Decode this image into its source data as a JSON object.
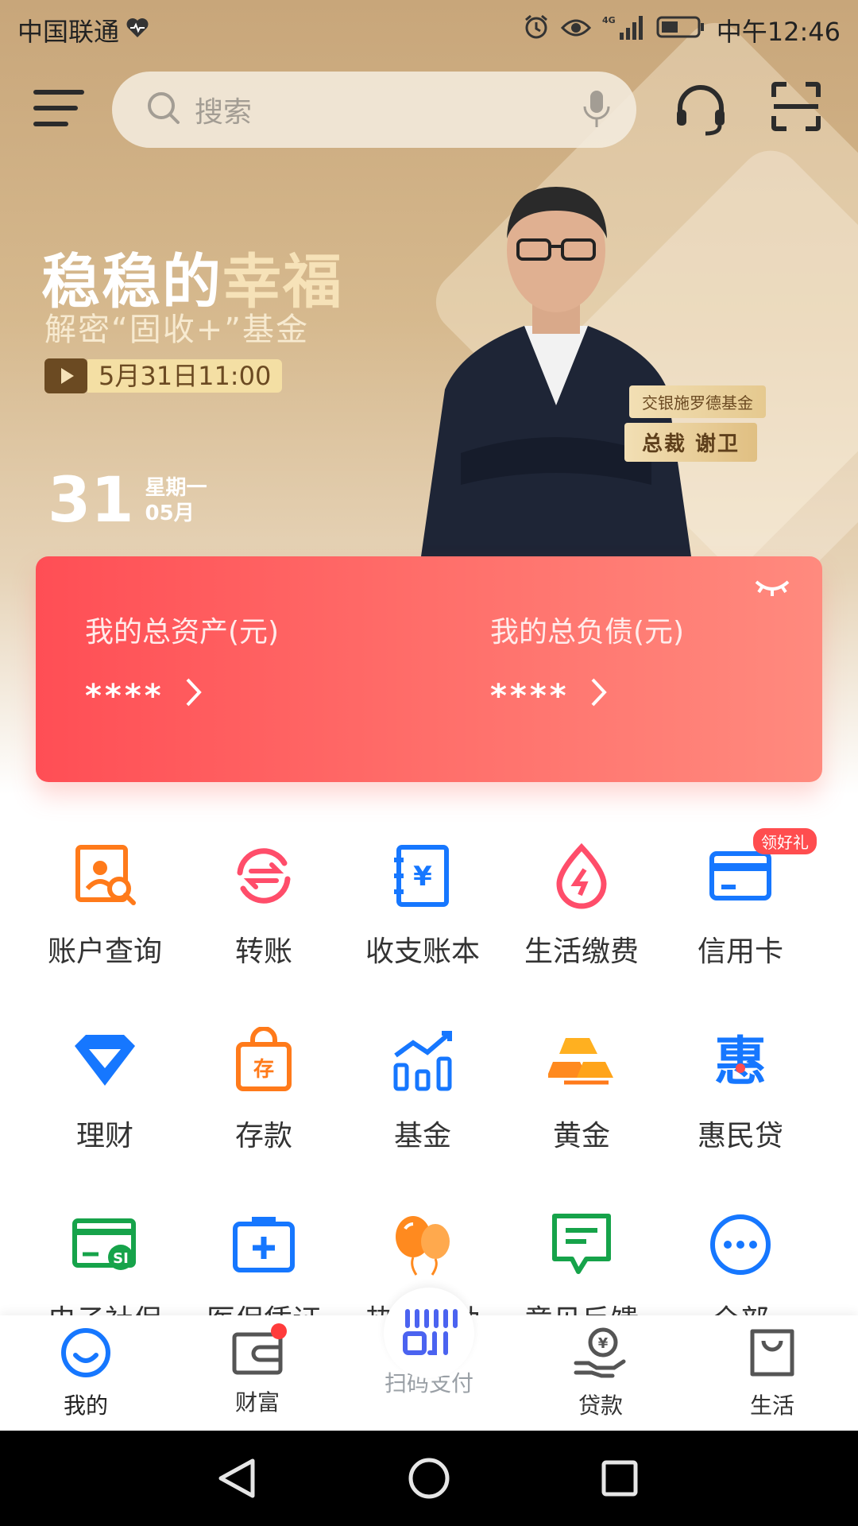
{
  "status_bar": {
    "carrier": "中国联通",
    "network": "4G",
    "time": "中午12:46"
  },
  "search": {
    "placeholder": "搜索"
  },
  "promo": {
    "title_part1": "稳稳的",
    "title_part2": "幸福",
    "subtitle": "解密“固收+”基金",
    "datetime": "5月31日11:00",
    "company": "交银施罗德基金",
    "person_title": "总裁 谢卫"
  },
  "date": {
    "day": "31",
    "weekday": "星期一",
    "month": "05月"
  },
  "assets": {
    "total_assets_label": "我的总资产(元)",
    "total_assets_value": "****",
    "total_liabilities_label": "我的总负债(元)",
    "total_liabilities_value": "****"
  },
  "services": [
    {
      "label": "账户查询",
      "icon": "account-query-icon"
    },
    {
      "label": "转账",
      "icon": "transfer-icon"
    },
    {
      "label": "收支账本",
      "icon": "ledger-icon"
    },
    {
      "label": "生活缴费",
      "icon": "bill-pay-icon"
    },
    {
      "label": "信用卡",
      "icon": "credit-card-icon",
      "badge": "领好礼"
    },
    {
      "label": "理财",
      "icon": "diamond-icon"
    },
    {
      "label": "存款",
      "icon": "deposit-icon"
    },
    {
      "label": "基金",
      "icon": "fund-chart-icon"
    },
    {
      "label": "黄金",
      "icon": "gold-bars-icon"
    },
    {
      "label": "惠民贷",
      "icon": "hui-loan-icon"
    },
    {
      "label": "电子社保",
      "icon": "social-security-icon"
    },
    {
      "label": "医保凭证",
      "icon": "medical-kit-icon"
    },
    {
      "label": "热门活动",
      "icon": "balloons-icon"
    },
    {
      "label": "意见反馈",
      "icon": "feedback-icon"
    },
    {
      "label": "全部",
      "icon": "more-icon"
    }
  ],
  "bottom_nav": [
    {
      "label": "我的"
    },
    {
      "label": "财富"
    },
    {
      "label": "扫码支付"
    },
    {
      "label": "贷款"
    },
    {
      "label": "生活"
    }
  ],
  "colors": {
    "accent_red": "#ff5a5f",
    "brand_blue": "#1677ff",
    "orange": "#ff8a1f",
    "gold_bg": "#d2b286"
  }
}
